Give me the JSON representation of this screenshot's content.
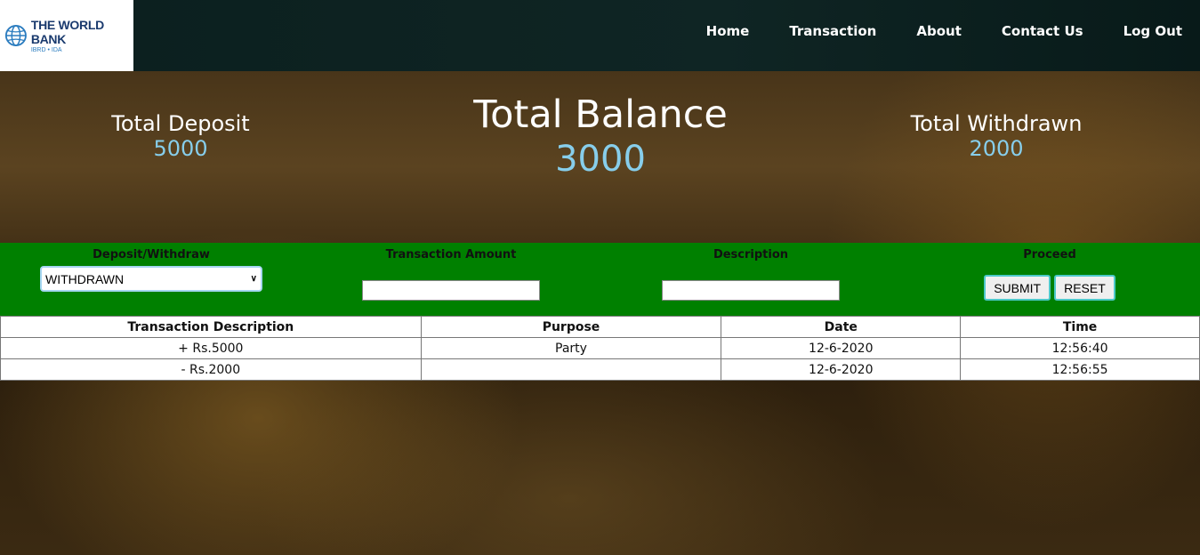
{
  "logo": {
    "name": "THE WORLD BANK",
    "sub": "IBRD • IDA"
  },
  "nav": [
    "Home",
    "Transaction",
    "About",
    "Contact Us",
    "Log Out"
  ],
  "summary": {
    "deposit_label": "Total Deposit",
    "deposit_value": "5000",
    "balance_label": "Total Balance",
    "balance_value": "3000",
    "withdrawn_label": "Total Withdrawn",
    "withdrawn_value": "2000"
  },
  "form": {
    "type_label": "Deposit/Withdraw",
    "type_value": "WITHDRAWN",
    "amount_label": "Transaction Amount",
    "description_label": "Description",
    "proceed_label": "Proceed",
    "submit_label": "SUBMIT",
    "reset_label": "RESET"
  },
  "table": {
    "headers": [
      "Transaction Description",
      "Purpose",
      "Date",
      "Time"
    ],
    "rows": [
      {
        "amount": "+ Rs.5000",
        "purpose": "Party",
        "date": "12-6-2020",
        "time": "12:56:40"
      },
      {
        "amount": "- Rs.2000",
        "purpose": "",
        "date": "12-6-2020",
        "time": "12:56:55"
      }
    ]
  },
  "colors": {
    "accent_green": "#008000",
    "value_blue": "#87ceeb",
    "deposit_green": "#006400",
    "withdraw_red": "#8b0000"
  }
}
